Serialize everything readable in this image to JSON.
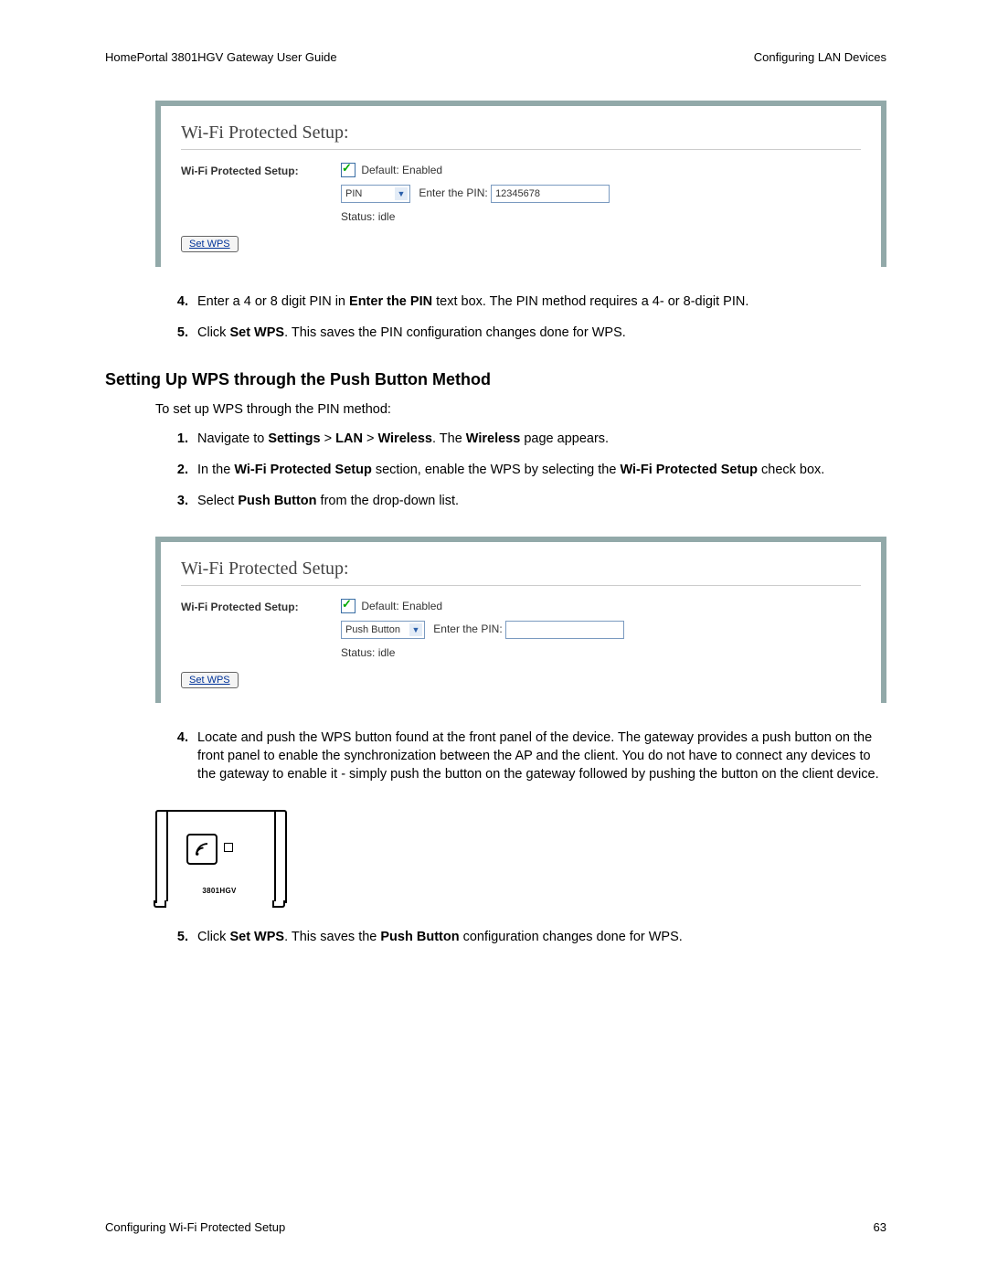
{
  "header": {
    "left": "HomePortal 3801HGV Gateway User Guide",
    "right": "Configuring LAN Devices"
  },
  "panel1": {
    "title": "Wi-Fi Protected Setup:",
    "row_label": "Wi-Fi Protected Setup:",
    "default_text": "Default: Enabled",
    "select_value": "PIN",
    "pin_label": "Enter the PIN:",
    "pin_value": "12345678",
    "status": "Status: idle",
    "button": "Set WPS"
  },
  "steps_a": {
    "s4_pre": "Enter a 4 or 8 digit PIN in ",
    "s4_b1": "Enter the PIN",
    "s4_post": " text box. The PIN method requires a 4- or 8-digit PIN.",
    "s5_pre": "Click ",
    "s5_b1": "Set WPS",
    "s5_post": ". This saves the PIN configuration changes done for WPS."
  },
  "section_heading": "Setting Up WPS through the Push Button Method",
  "lead": "To set up WPS through the PIN method:",
  "steps_b": {
    "s1_pre": "Navigate to ",
    "s1_b1": "Settings",
    "s1_m1": " > ",
    "s1_b2": "LAN",
    "s1_m2": " > ",
    "s1_b3": "Wireless",
    "s1_m3": ". The ",
    "s1_b4": "Wireless",
    "s1_post": " page appears.",
    "s2_pre": "In the ",
    "s2_b1": "Wi-Fi Protected Setup",
    "s2_m1": " section, enable the WPS by selecting the ",
    "s2_b2": "Wi-Fi Protected Setup",
    "s2_post": " check box.",
    "s3_pre": "Select ",
    "s3_b1": "Push Button",
    "s3_post": " from the drop-down list."
  },
  "panel2": {
    "title": "Wi-Fi Protected Setup:",
    "row_label": "Wi-Fi Protected Setup:",
    "default_text": "Default: Enabled",
    "select_value": "Push Button",
    "pin_label": "Enter the PIN:",
    "pin_value": "",
    "status": "Status: idle",
    "button": "Set WPS"
  },
  "steps_c": {
    "s4": "Locate and push the WPS button found at the front panel of the device. The gateway provides a push button on the front panel to enable the synchronization between the AP and the client. You do not have to connect any devices to the gateway to enable it - simply push the button on the gateway followed by pushing the button on the client device.",
    "s5_pre": "Click ",
    "s5_b1": "Set WPS",
    "s5_m1": ". This saves the ",
    "s5_b2": "Push Button",
    "s5_post": " configuration changes done for WPS."
  },
  "device_label": "3801HGV",
  "footer": {
    "left": "Configuring Wi-Fi Protected Setup",
    "right": "63"
  }
}
